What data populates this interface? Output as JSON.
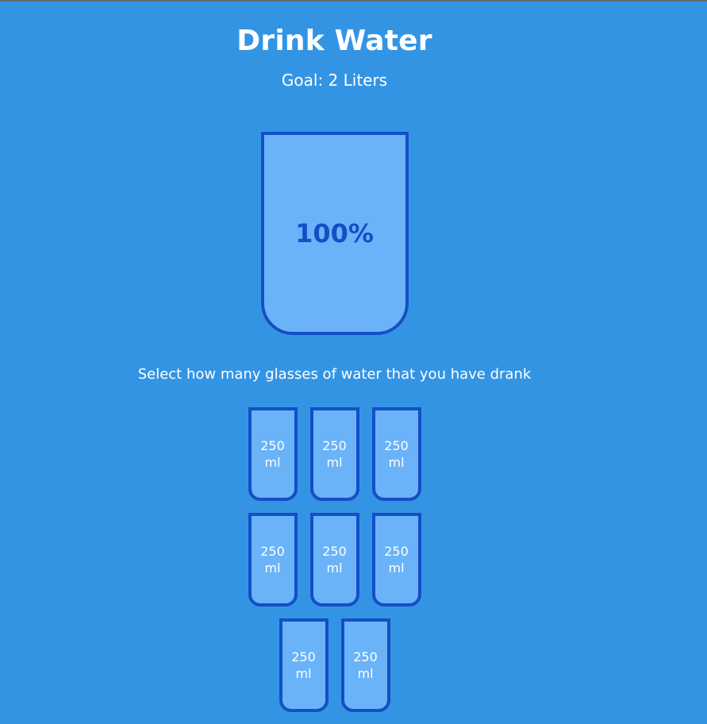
{
  "header": {
    "title": "Drink Water",
    "goal": "Goal: 2 Liters"
  },
  "big_cup": {
    "fill_fraction": 1.0,
    "percentage_text": "100%",
    "fill_color": "#6ab3f8",
    "border_color": "#144fc6"
  },
  "instructions": "Select how many glasses of water that you have drank",
  "cups": [
    {
      "amount": "250",
      "unit": "ml",
      "full": true
    },
    {
      "amount": "250",
      "unit": "ml",
      "full": true
    },
    {
      "amount": "250",
      "unit": "ml",
      "full": true
    },
    {
      "amount": "250",
      "unit": "ml",
      "full": true
    },
    {
      "amount": "250",
      "unit": "ml",
      "full": true
    },
    {
      "amount": "250",
      "unit": "ml",
      "full": true
    },
    {
      "amount": "250",
      "unit": "ml",
      "full": true
    },
    {
      "amount": "250",
      "unit": "ml",
      "full": true
    }
  ],
  "colors": {
    "background": "#3494e4",
    "cup_fill": "#6ab3f8",
    "cup_border": "#144fc6",
    "text": "#ffffff"
  }
}
